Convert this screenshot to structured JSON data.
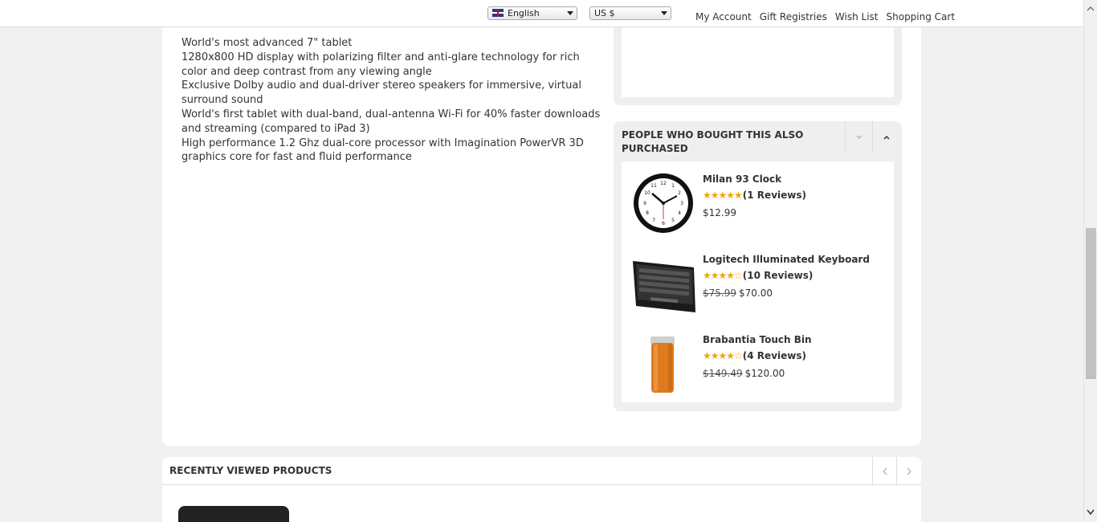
{
  "topbar": {
    "language": "English",
    "currency": "US $",
    "links": [
      "My Account",
      "Gift Registries",
      "Wish List",
      "Shopping Cart"
    ]
  },
  "features": [
    "World's most advanced 7\" tablet",
    "1280x800 HD display with polarizing filter and anti-glare technology for rich color and deep contrast from any viewing angle",
    "Exclusive Dolby audio and dual-driver stereo speakers for immersive, virtual surround sound",
    "World's first tablet with dual-band, dual-antenna Wi-Fi for 40% faster downloads and streaming (compared to iPad 3)",
    "High performance 1.2 Ghz dual-core processor with Imagination PowerVR 3D graphics core for fast and fluid performance"
  ],
  "also_purchased": {
    "title": "PEOPLE WHO BOUGHT THIS ALSO PURCHASED",
    "products": [
      {
        "name": "Milan 93 Clock",
        "stars": "★★★★★",
        "reviews": "(1 Reviews)",
        "old_price": "",
        "price": "$12.99",
        "image": "clock"
      },
      {
        "name": "Logitech Illuminated Keyboard",
        "stars": "★★★★☆",
        "reviews": "(10 Reviews)",
        "old_price": "$75.99",
        "price": "$70.00",
        "image": "keyboard"
      },
      {
        "name": "Brabantia Touch Bin",
        "stars": "★★★★☆",
        "reviews": "(4 Reviews)",
        "old_price": "$149.49",
        "price": "$120.00",
        "image": "bin"
      }
    ]
  },
  "recent": {
    "title": "RECENTLY VIEWED PRODUCTS"
  }
}
